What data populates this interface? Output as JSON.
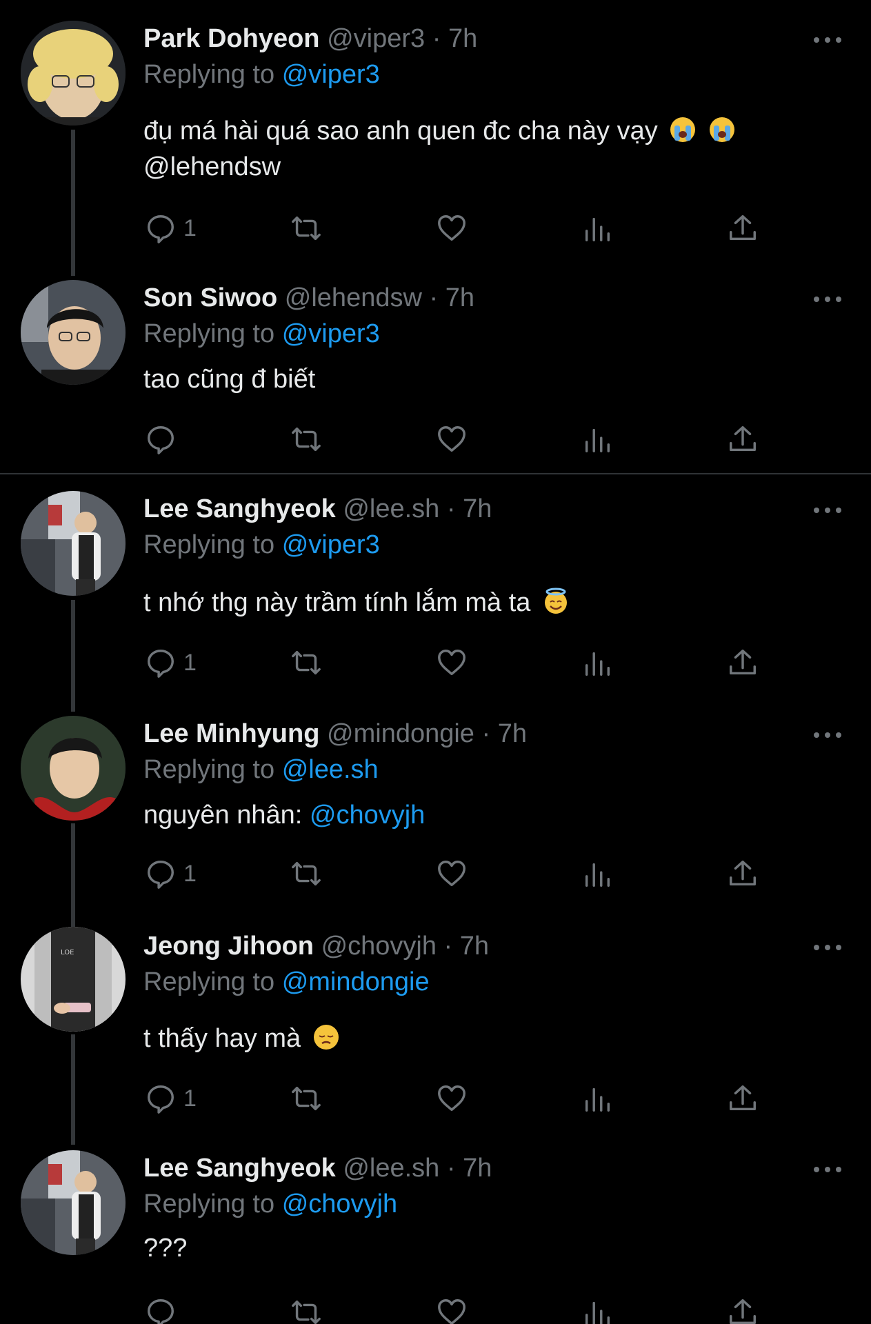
{
  "tweets": [
    {
      "name": "Park Dohyeon",
      "handle": "@viper3",
      "time": "· 7h",
      "replying_label": "Replying to",
      "replying_to": "@viper3",
      "text_line1": "đụ má hài quá sao anh quen đc cha này vạy",
      "text_line2": "@lehendsw",
      "emoji": "loudly-crying-face",
      "reply_count": "1",
      "avatar_color": "#e8d27a"
    },
    {
      "name": "Son Siwoo",
      "handle": "@lehendsw",
      "time": "· 7h",
      "replying_label": "Replying to",
      "replying_to": "@viper3",
      "text_line1": "tao cũng đ biết",
      "reply_count": "",
      "avatar_color": "#4a5058"
    },
    {
      "name": "Lee Sanghyeok",
      "handle": "@lee.sh",
      "time": "· 7h",
      "replying_label": "Replying to",
      "replying_to": "@viper3",
      "text_line1": "t nhớ thg này trầm tính lắm mà ta",
      "emoji": "smiling-face-with-halo",
      "reply_count": "1",
      "avatar_color": "#5a5f66"
    },
    {
      "name": "Lee Minhyung",
      "handle": "@mindongie",
      "time": "· 7h",
      "replying_label": "Replying to",
      "replying_to": "@lee.sh",
      "text_prefix": "nguyên nhân: ",
      "text_mention": "@chovyjh",
      "reply_count": "1",
      "avatar_color": "#7a1c1c"
    },
    {
      "name": "Jeong Jihoon",
      "handle": "@chovyjh",
      "time": "· 7h",
      "replying_label": "Replying to",
      "replying_to": "@mindongie",
      "text_line1": "t thấy hay mà",
      "emoji": "pensive-face",
      "reply_count": "1",
      "avatar_color": "#cfcfcf"
    },
    {
      "name": "Lee Sanghyeok",
      "handle": "@lee.sh",
      "time": "· 7h",
      "replying_label": "Replying to",
      "replying_to": "@chovyjh",
      "text_line1": "???",
      "reply_count": "",
      "avatar_color": "#5a5f66"
    }
  ],
  "icons": {
    "reply": "reply-icon",
    "retweet": "retweet-icon",
    "like": "heart-icon",
    "views": "views-icon",
    "share": "share-icon",
    "more": "more-icon"
  },
  "colors": {
    "background": "#000000",
    "text": "#e7e9ea",
    "muted": "#71767b",
    "accent": "#1d9bf0",
    "divider": "#2f3336"
  }
}
